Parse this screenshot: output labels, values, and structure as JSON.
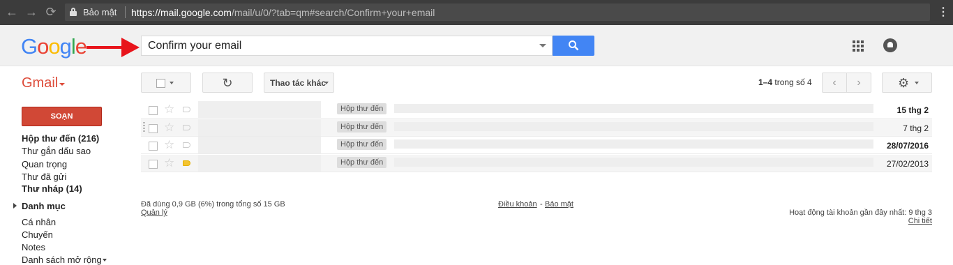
{
  "browser": {
    "secure_label": "Bảo mật",
    "url_host": "https://mail.google.com",
    "url_path": "/mail/u/0/?tab=qm#search/Confirm+your+email"
  },
  "header": {
    "logo_letters": [
      {
        "char": "G",
        "color": "#4285f4"
      },
      {
        "char": "o",
        "color": "#ea4335"
      },
      {
        "char": "o",
        "color": "#fbbc05"
      },
      {
        "char": "g",
        "color": "#4285f4"
      },
      {
        "char": "l",
        "color": "#34a853"
      },
      {
        "char": "e",
        "color": "#ea4335"
      }
    ],
    "search_value": "Confirm your email",
    "arrow_color": "#e8141b"
  },
  "toolbar": {
    "gmail_label": "Gmail",
    "more_actions": "Thao tác khác",
    "pagination_range": "1–4",
    "pagination_suffix": " trong số 4"
  },
  "sidebar": {
    "compose": "SOẠN",
    "items": [
      {
        "label": "Hộp thư đến (216)",
        "bold": true
      },
      {
        "label": "Thư gắn dấu sao",
        "bold": false
      },
      {
        "label": "Quan trọng",
        "bold": false
      },
      {
        "label": "Thư đã gửi",
        "bold": false
      },
      {
        "label": "Thư nháp (14)",
        "bold": true
      }
    ],
    "categories": "Danh mục",
    "sub_items": [
      "Cá nhân",
      "Chuyến",
      "Notes",
      "Danh sách mở rộng"
    ]
  },
  "emails": [
    {
      "label": "Hộp thư đến",
      "date": "15 thg 2",
      "unread": true,
      "important": false
    },
    {
      "label": "Hộp thư đến",
      "date": "7 thg 2",
      "unread": false,
      "important": false
    },
    {
      "label": "Hộp thư đến",
      "date": "28/07/2016",
      "unread": true,
      "important": false
    },
    {
      "label": "Hộp thư đến",
      "date": "27/02/2013",
      "unread": false,
      "important": true
    }
  ],
  "footer": {
    "storage": "Đã dùng 0,9 GB (6%) trong tổng số 15 GB",
    "manage": "Quản lý",
    "terms": "Điều khoản",
    "dash": "-",
    "privacy": "Bảo mật",
    "activity": "Hoạt động tài khoản gần đây nhất: 9 thg 3",
    "details": "Chi tiết"
  }
}
